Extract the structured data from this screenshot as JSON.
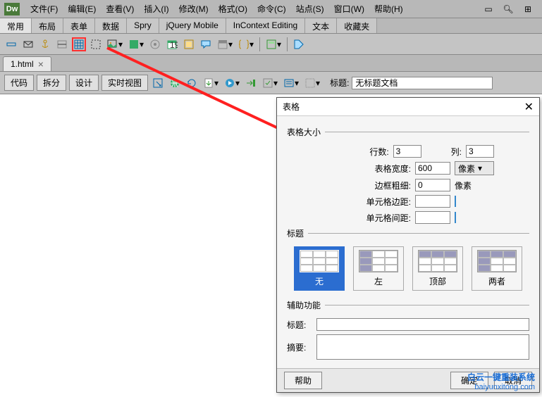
{
  "app": {
    "logo": "Dw"
  },
  "menu": {
    "items": [
      "文件(F)",
      "编辑(E)",
      "查看(V)",
      "插入(I)",
      "修改(M)",
      "格式(O)",
      "命令(C)",
      "站点(S)",
      "窗口(W)",
      "帮助(H)"
    ]
  },
  "categoryTabs": {
    "items": [
      "常用",
      "布局",
      "表单",
      "数据",
      "Spry",
      "jQuery Mobile",
      "InContext Editing",
      "文本",
      "收藏夹"
    ],
    "activeIndex": 0
  },
  "fileTab": {
    "name": "1.html"
  },
  "viewButtons": {
    "code": "代码",
    "split": "拆分",
    "design": "设计",
    "live": "实时视图"
  },
  "titleField": {
    "label": "标题:",
    "value": "无标题文档"
  },
  "dialog": {
    "title": "表格",
    "sections": {
      "size": "表格大小",
      "header": "标题",
      "access": "辅助功能"
    },
    "fields": {
      "rows": {
        "label": "行数:",
        "value": "3"
      },
      "cols": {
        "label": "列:",
        "value": "3"
      },
      "width": {
        "label": "表格宽度:",
        "value": "600",
        "unit": "像素"
      },
      "border": {
        "label": "边框粗细:",
        "value": "0",
        "unit": "像素"
      },
      "cellpadding": {
        "label": "单元格边距:",
        "value": ""
      },
      "cellspacing": {
        "label": "单元格间距:",
        "value": ""
      }
    },
    "headerOpts": {
      "none": "无",
      "left": "左",
      "top": "顶部",
      "both": "两者",
      "selectedIndex": 0
    },
    "access": {
      "caption": "标题:",
      "summary": "摘要:"
    },
    "buttons": {
      "help": "帮助",
      "ok": "确定",
      "cancel": "取消"
    }
  },
  "watermark": {
    "line1": "白云一键重装系统",
    "line2": "baiyunxitong.com"
  }
}
